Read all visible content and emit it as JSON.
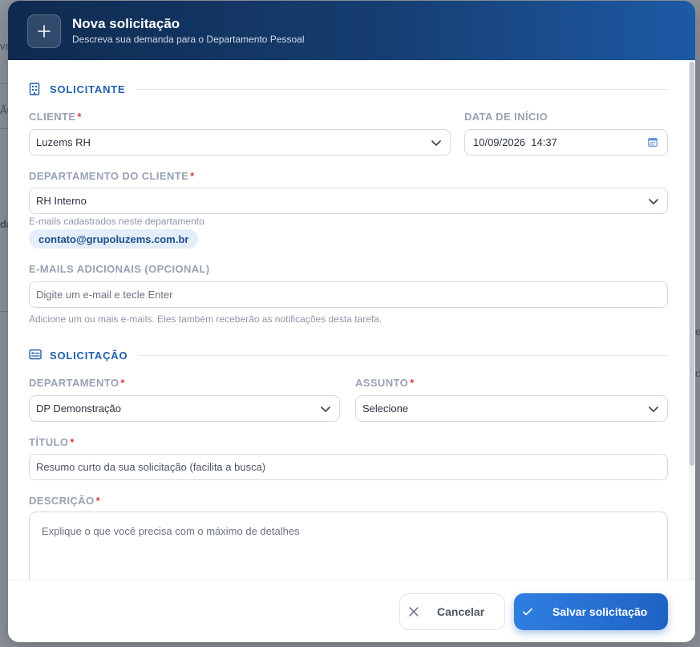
{
  "background_fragments": [
    "va",
    "ÃO",
    "da",
    "e",
    "c"
  ],
  "modal": {
    "title": "Nova solicitação",
    "subtitle": "Descreva sua demanda para o Departamento Pessoal",
    "header_icon": "plus-icon"
  },
  "section_requester": {
    "icon": "building-icon",
    "title": "SOLICITANTE",
    "client": {
      "label": "CLIENTE",
      "required": "*",
      "value": "Luzems RH"
    },
    "start_date": {
      "label": "DATA DE INÍCIO",
      "value": "10/09/2026  14:37",
      "icon": "calendar-icon"
    },
    "client_department": {
      "label": "DEPARTAMENTO DO CLIENTE",
      "required": "*",
      "value": "RH Interno"
    },
    "registered_emails_hint": "E-mails cadastrados neste departamento",
    "registered_emails": [
      "contato@grupoluzems.com.br"
    ],
    "additional_emails": {
      "label": "E-MAILS ADICIONAIS (OPCIONAL)",
      "placeholder": "Digite um e-mail e tecle Enter",
      "hint": "Adicione um ou mais e-mails. Eles também receberão as notificações desta tarefa."
    }
  },
  "section_request": {
    "icon": "id-card-icon",
    "title": "SOLICITAÇÃO",
    "department": {
      "label": "DEPARTAMENTO",
      "required": "*",
      "value": "DP Demonstração"
    },
    "subject": {
      "label": "ASSUNTO",
      "required": "*",
      "value": "Selecione"
    },
    "title_field": {
      "label": "TÍTULO",
      "required": "*",
      "placeholder": "Resumo curto da sua solicitação (facilita a busca)"
    },
    "description": {
      "label": "DESCRIÇÃO",
      "required": "*",
      "placeholder": "Explique o que você precisa com o máximo de detalhes"
    }
  },
  "footer": {
    "cancel_label": "Cancelar",
    "save_label": "Salvar solicitação"
  },
  "colors": {
    "header_start": "#0f2a4f",
    "header_end": "#1d5aa5",
    "accent": "#1f5fa8",
    "required": "#e03b3b",
    "primary_button": "#2f7fe0"
  }
}
